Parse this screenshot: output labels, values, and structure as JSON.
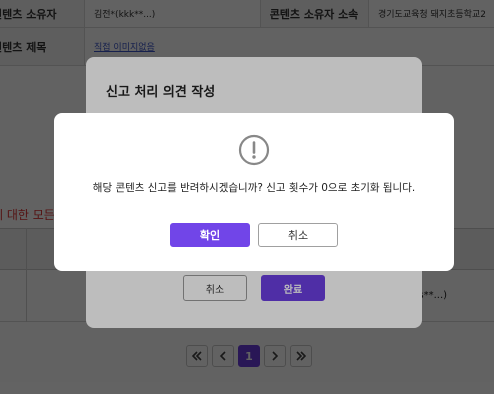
{
  "background": {
    "row1": {
      "owner_label": "컨텐츠 소유자",
      "owner_value": "김전*(kkk**...)",
      "org_label": "콘텐츠 소유자 소속",
      "org_value": "경기도교육청 돼지초등학교2"
    },
    "row2": {
      "title_label": "컨텐츠 제목",
      "title_value": "직접 이미지없음"
    },
    "red_notice": "에 대한 모든 ?",
    "row_tail_text": "sss**...)"
  },
  "pagination": {
    "first_icon": "double-chevron-left-icon",
    "prev_icon": "chevron-left-icon",
    "current_page": "1",
    "next_icon": "chevron-right-icon",
    "last_icon": "double-chevron-right-icon"
  },
  "report_modal": {
    "title": "신고 처리 의견 작성",
    "cancel_label": "취소",
    "done_label": "완료"
  },
  "confirm_dialog": {
    "icon": "exclamation-circle-icon",
    "message": "해당 콘텐츠 신고를 반려하시겠습니까? 신고 횟수가 0으로 초기화 됩니다.",
    "ok_label": "확인",
    "cancel_label": "취소"
  },
  "colors": {
    "accent": "#7145e8",
    "danger_text": "#dd3333",
    "link": "#3a55c8"
  }
}
